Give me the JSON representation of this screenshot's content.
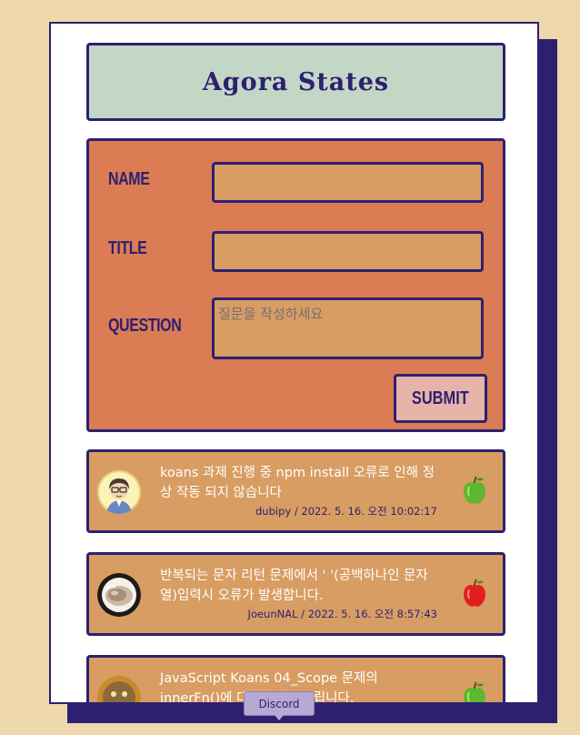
{
  "header": {
    "title": "Agora States"
  },
  "form": {
    "name_label": "NAME",
    "title_label": "TITLE",
    "question_label": "QUESTION",
    "name_value": "",
    "title_value": "",
    "question_placeholder": "질문을 작성하세요",
    "submit_label": "SUBMIT"
  },
  "discussions": [
    {
      "title": "koans 과제 진행 중 npm install 오류로 인해 정상 작동 되지 않습니다",
      "meta": "dubipy / 2022. 5. 16. 오전 10:02:17",
      "answered": true,
      "apple": "green-apple"
    },
    {
      "title": "반복되는 문자 리턴 문제에서 ' '(공백하나인 문자열)입력시 오류가 발생합니다.",
      "meta": "JoeunNAL / 2022. 5. 16. 오전 8:57:43",
      "answered": false,
      "apple": "red-apple"
    },
    {
      "title": "JavaScript Koans 04_Scope 문제의 innerFn()에 대하여 질문드립니다.",
      "meta": "",
      "answered": true,
      "apple": "green-apple"
    }
  ],
  "tooltip": {
    "text": "Discord"
  },
  "colors": {
    "background": "#f0d8ad",
    "navy": "#2e2070",
    "header_bg": "#c3d7c6",
    "form_bg": "#dc7c55",
    "input_bg": "#d89d62",
    "submit_bg": "#e6b4a8"
  }
}
